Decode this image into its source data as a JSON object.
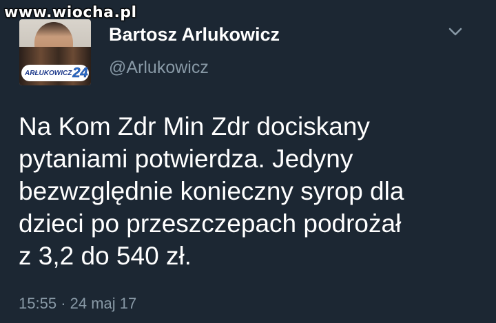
{
  "watermark": "www.wiocha.pl",
  "tweet": {
    "author": {
      "name": "Bartosz Arlukowicz",
      "handle": "@Arlukowicz",
      "avatar_badge_text": "ARŁUKOWICZ",
      "avatar_badge_number": "24"
    },
    "lines": [
      "Na Kom Zdr Min Zdr dociskany",
      "pytaniami potwierdza. Jedyny",
      "bezwzględnie konieczny syrop dla",
      "dzieci po przeszczepach podrożał",
      "z 3,2 do 540 zł."
    ],
    "time": "15:55",
    "separator": "·",
    "date": "24 maj 17"
  },
  "icons": {
    "menu": "chevron-down-icon"
  },
  "colors": {
    "background": "#1c2733",
    "text": "#ffffff",
    "secondary": "#8899a6"
  }
}
